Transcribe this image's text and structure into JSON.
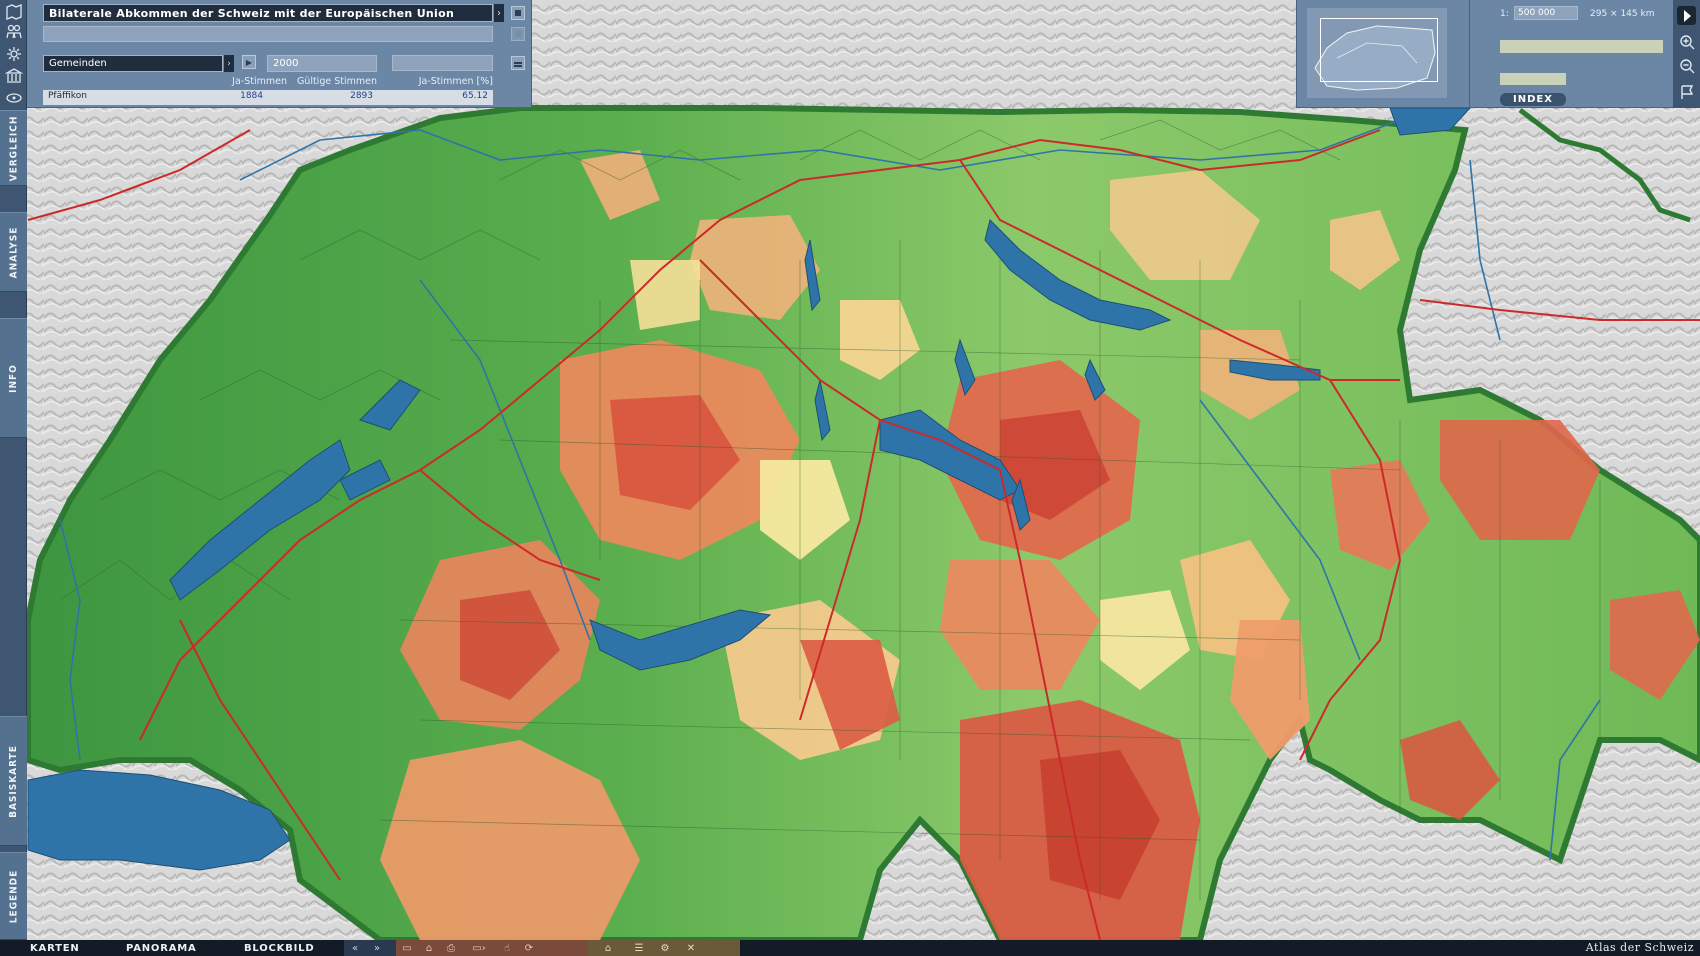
{
  "app": {
    "title": "Bilaterale Abkommen der Schweiz mit der Europäischen Union",
    "brand": "Atlas der Schweiz"
  },
  "selector": {
    "level": "Gemeinden",
    "year": "2000"
  },
  "table": {
    "columns": [
      "Ja-Stimmen",
      "Gültige Stimmen",
      "Ja-Stimmen [%]"
    ],
    "row": {
      "name": "Pfäffikon",
      "ja": "1884",
      "gueltig": "2893",
      "prozent": "65.12"
    }
  },
  "scale": {
    "prefix": "1:",
    "value": "500 000",
    "extent": "295 × 145 km"
  },
  "index_label": "INDEX",
  "side_tabs": [
    "VERGLEICH",
    "ANALYSE",
    "INFO",
    "BASISKARTE",
    "LEGENDE"
  ],
  "bottom_tabs": [
    "KARTEN",
    "PANORAMA",
    "BLOCKBILD"
  ],
  "icons": {
    "left": [
      "map-icon",
      "people-icon",
      "settings-icon",
      "bank-icon",
      "layers-icon"
    ],
    "right": [
      "pointer-icon",
      "zoom-in-icon",
      "zoom-out-icon",
      "flag-icon"
    ]
  },
  "colors": {
    "panel": "#6c87a6",
    "panel_dark": "#1f2d3e",
    "yes_high": "#3f9a3c",
    "yes_mid": "#9fd07a",
    "neutral": "#f5e7a2",
    "no_mid": "#f0a86c",
    "no_high": "#dc5a42",
    "water": "#2f74a8",
    "road": "#cc2a2a"
  }
}
